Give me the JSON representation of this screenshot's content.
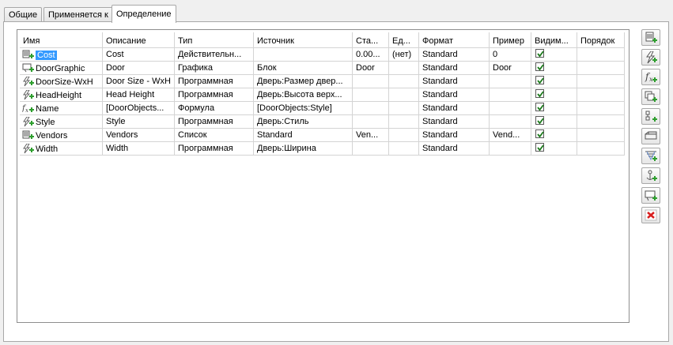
{
  "tabs": [
    {
      "label": "Общие",
      "active": false
    },
    {
      "label": "Применяется к",
      "active": false
    },
    {
      "label": "Определение",
      "active": true
    }
  ],
  "columns": [
    "Имя",
    "Описание",
    "Тип",
    "Источник",
    "Ста...",
    "Ед...",
    "Формат",
    "Пример",
    "Видим...",
    "Порядок"
  ],
  "rows": [
    {
      "icon": "list-property-icon",
      "name": "Cost",
      "selected": true,
      "description": "Cost",
      "type": "Действительн...",
      "source": "",
      "start": "0.00...",
      "units": "(нет)",
      "format": "Standard",
      "example": "0",
      "visible": true,
      "order": ""
    },
    {
      "icon": "graphic-property-icon",
      "name": "DoorGraphic",
      "selected": false,
      "description": "Door",
      "type": "Графика",
      "source": "Блок",
      "start": "Door",
      "units": "",
      "format": "Standard",
      "example": "Door",
      "visible": true,
      "order": ""
    },
    {
      "icon": "automatic-property-icon",
      "name": "DoorSize-WxH",
      "selected": false,
      "description": "Door Size - WxH",
      "type": "Программная",
      "source": "Дверь:Размер двер...",
      "start": "",
      "units": "",
      "format": "Standard",
      "example": "",
      "visible": true,
      "order": ""
    },
    {
      "icon": "automatic-property-icon",
      "name": "HeadHeight",
      "selected": false,
      "description": "Head Height",
      "type": "Программная",
      "source": "Дверь:Высота верх...",
      "start": "",
      "units": "",
      "format": "Standard",
      "example": "",
      "visible": true,
      "order": ""
    },
    {
      "icon": "formula-property-icon",
      "name": "Name",
      "selected": false,
      "description": "[DoorObjects...",
      "type": "Формула",
      "source": "[DoorObjects:Style]",
      "start": "",
      "units": "",
      "format": "Standard",
      "example": "",
      "visible": true,
      "order": ""
    },
    {
      "icon": "automatic-property-icon",
      "name": "Style",
      "selected": false,
      "description": "Style",
      "type": "Программная",
      "source": "Дверь:Стиль",
      "start": "",
      "units": "",
      "format": "Standard",
      "example": "",
      "visible": true,
      "order": ""
    },
    {
      "icon": "list-property-icon",
      "name": "Vendors",
      "selected": false,
      "description": "Vendors",
      "type": "Список",
      "source": "Standard",
      "start": "Ven...",
      "units": "",
      "format": "Standard",
      "example": "Vend...",
      "visible": true,
      "order": ""
    },
    {
      "icon": "automatic-property-icon",
      "name": "Width",
      "selected": false,
      "description": "Width",
      "type": "Программная",
      "source": "Дверь:Ширина",
      "start": "",
      "units": "",
      "format": "Standard",
      "example": "",
      "visible": true,
      "order": ""
    }
  ],
  "toolbar": [
    "add-manual-property-icon",
    "add-automatic-property-icon",
    "add-formula-property-icon",
    "add-location-property-icon",
    "add-classification-property-icon",
    "add-material-property-icon",
    "add-property-set-icon",
    "add-anchor-property-icon",
    "add-graphic-property-icon",
    "delete-property-icon"
  ],
  "colors": {
    "selection": "#3399ff",
    "add_plus": "#2e9e2e",
    "delete": "#d81e1e",
    "check": "#1b7a1b"
  }
}
